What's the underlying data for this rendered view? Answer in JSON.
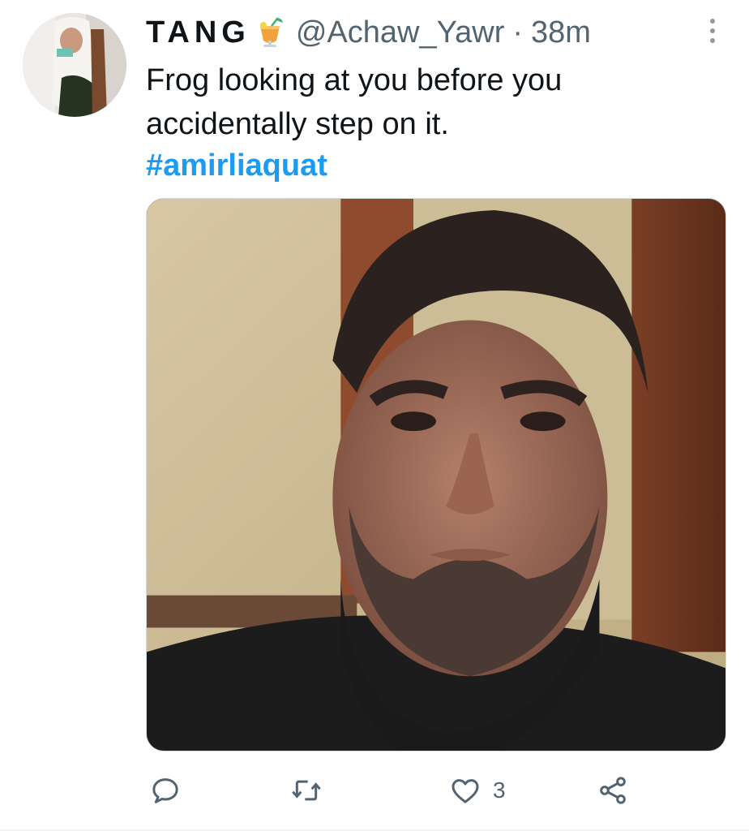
{
  "tweet": {
    "display_name": "TANG",
    "name_emoji": "tropical-drink-emoji",
    "handle": "@Achaw_Yawr",
    "separator": "·",
    "time": "38m",
    "text": "Frog looking at you before you accidentally step on it.",
    "hashtag": "#amirliaquat",
    "media_alt": "photo of a man with a beard staring at the camera",
    "actions": {
      "reply_icon": "reply-icon",
      "retweet_icon": "retweet-icon",
      "like_icon": "heart-icon",
      "like_count": "3",
      "share_icon": "share-icon"
    },
    "colors": {
      "link": "#1d9bf0",
      "secondary_text": "#536471",
      "primary_text": "#0f1419"
    }
  }
}
